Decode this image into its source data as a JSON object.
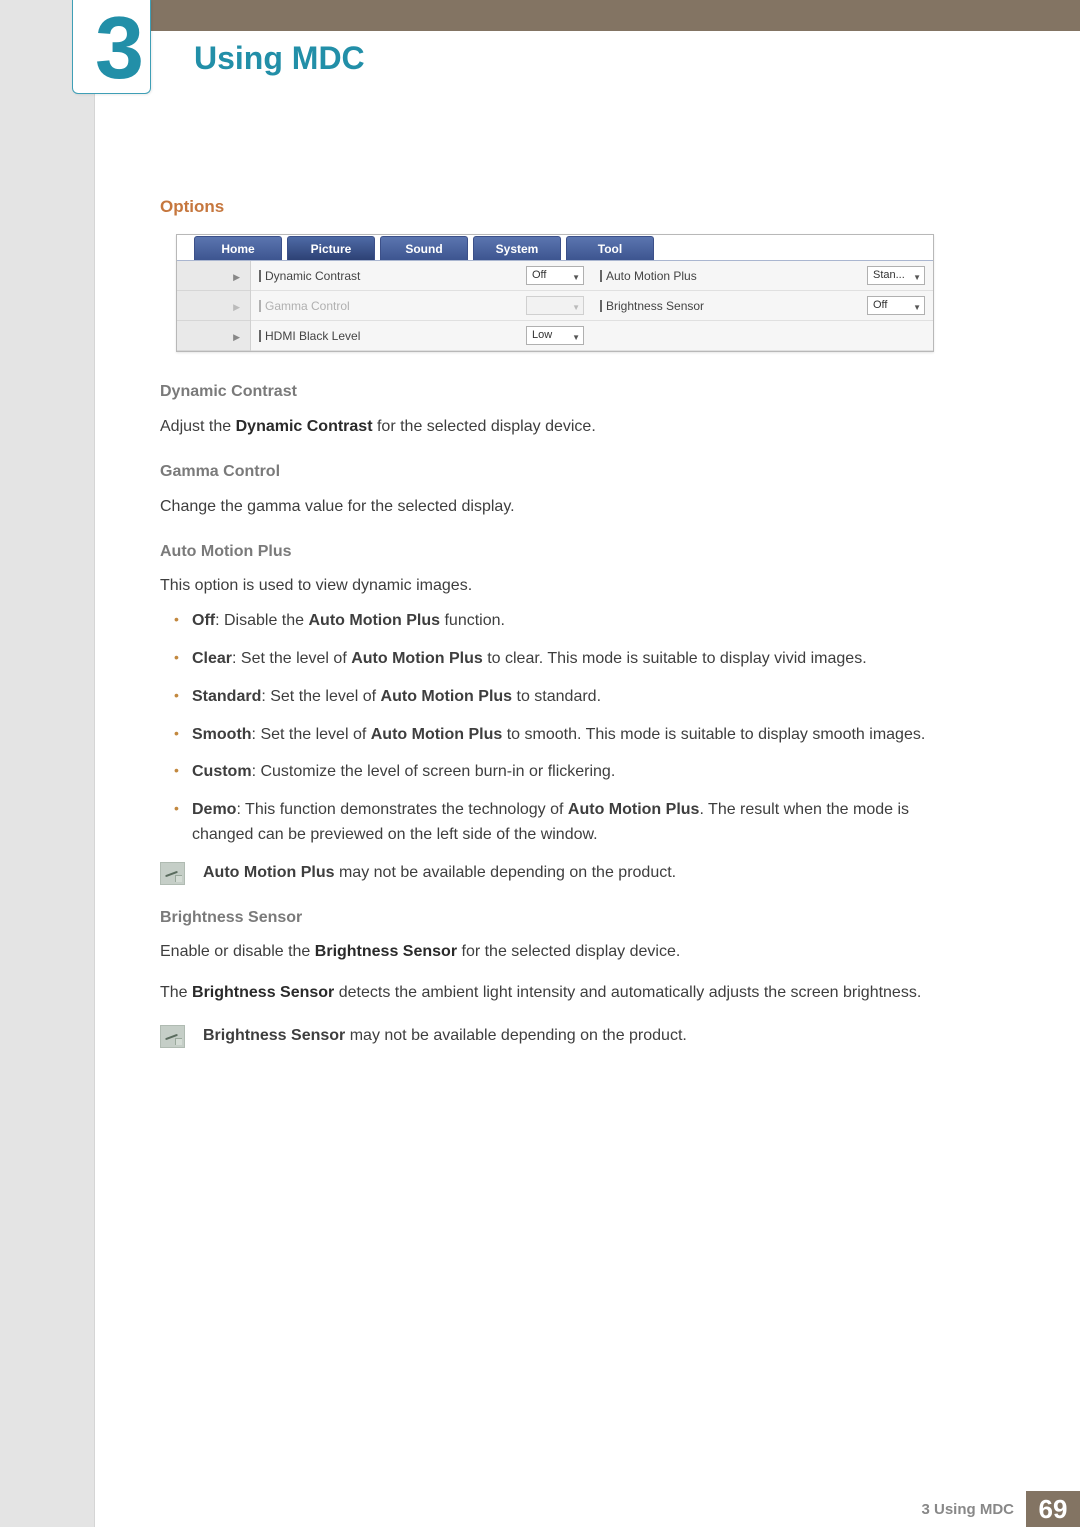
{
  "chapter": {
    "number": "3",
    "title": "Using MDC"
  },
  "section": {
    "heading": "Options"
  },
  "app": {
    "tabs": [
      "Home",
      "Picture",
      "Sound",
      "System",
      "Tool"
    ],
    "active_tab_index": 1,
    "fields": {
      "dynamic_contrast": {
        "label": "Dynamic Contrast",
        "value": "Off"
      },
      "gamma_control": {
        "label": "Gamma Control",
        "value": ""
      },
      "hdmi_black_level": {
        "label": "HDMI Black Level",
        "value": "Low"
      },
      "auto_motion_plus": {
        "label": "Auto Motion Plus",
        "value": "Stan..."
      },
      "brightness_sensor": {
        "label": "Brightness Sensor",
        "value": "Off"
      }
    }
  },
  "dynamic_contrast": {
    "heading": "Dynamic Contrast",
    "text_pre": "Adjust the ",
    "text_bold": "Dynamic Contrast",
    "text_post": " for the selected display device."
  },
  "gamma_control": {
    "heading": "Gamma Control",
    "text": "Change the gamma value for the selected display."
  },
  "amp": {
    "heading": "Auto Motion Plus",
    "intro": "This option is used to view dynamic images.",
    "items": {
      "off": {
        "b": "Off",
        "t1": ": Disable the ",
        "b2": "Auto Motion Plus",
        "t2": " function."
      },
      "clear": {
        "b": "Clear",
        "t1": ": Set the level of ",
        "b2": "Auto Motion Plus",
        "t2": " to clear. This mode is suitable to display vivid images."
      },
      "standard": {
        "b": "Standard",
        "t1": ": Set the level of ",
        "b2": "Auto Motion Plus",
        "t2": " to standard."
      },
      "smooth": {
        "b": "Smooth",
        "t1": ": Set the level of ",
        "b2": "Auto Motion Plus",
        "t2": " to smooth. This mode is suitable to display smooth images."
      },
      "custom": {
        "b": "Custom",
        "t1": ": Customize the level of screen burn-in or flickering."
      },
      "demo": {
        "b": "Demo",
        "t1": ": This function demonstrates the technology of ",
        "b2": "Auto Motion Plus",
        "t2": ". The result when the mode is changed can be previewed on the left side of the window."
      }
    },
    "note_bold": "Auto Motion Plus",
    "note_rest": " may not be available depending on the product."
  },
  "bs": {
    "heading": "Brightness Sensor",
    "p1_pre": "Enable or disable the ",
    "p1_bold": "Brightness Sensor",
    "p1_post": " for the selected display device.",
    "p2_pre": "The ",
    "p2_bold": "Brightness Sensor",
    "p2_post": " detects the ambient light intensity and automatically adjusts the screen brightness.",
    "note_bold": "Brightness Sensor",
    "note_rest": " may not be available depending on the product."
  },
  "footer": {
    "label": "3 Using MDC",
    "page": "69"
  }
}
